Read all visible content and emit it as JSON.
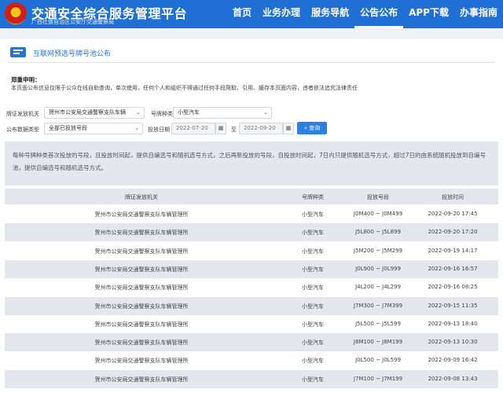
{
  "header": {
    "emblem_text": "★",
    "title": "交通安全综合服务管理平台",
    "subtitle": "广西壮族自治区公安厅交通警察局",
    "nav": [
      "首页",
      "业务办理",
      "服务导航",
      "公告公布",
      "APP下载",
      "办事指南"
    ],
    "active_nav": "公告公布",
    "brand_color": "#1f6fd4"
  },
  "page": {
    "title": "互联网预选号牌号池公布"
  },
  "notice": {
    "heading": "郑重申明：",
    "text": "本页面公布信息仅限于公众在线自助查询，单次使用，任何个人和组织不得通过任何手段爬取、引用、缓存本页面内容，违者依法追究法律责任"
  },
  "filters": {
    "issuer_label": "牌证发放机关",
    "issuer_value": "贺州市公安局交通警察支队车辆",
    "plate_type_label": "号牌种类",
    "plate_type_value": "小型汽车",
    "data_type_label": "公布数据类型",
    "data_type_value": "全部已投放号段",
    "date_label": "投放日期",
    "date_from": "2022-07-20",
    "date_sep": "至",
    "date_to": "2022-09-20",
    "calendar_icon": "▦",
    "query_button": "查询",
    "query_icon": "search-icon"
  },
  "info_text": "每种号牌种类首次投放的号段，且投放时间起，提供自编选号和随机选号方式，之后再新投放的号段，自投放时间起，7日内只提供随机选号方式，超过7日的由系统随机投放到自编号池，提供自编选号和随机选号方式。",
  "table": {
    "columns": [
      "牌证发放机关",
      "号牌种类",
      "投放号段",
      "投放时间"
    ],
    "rows": [
      [
        "贺州市公安局交通警察支队车辆管理所",
        "小型汽车",
        "J0M400 ~ J0M499",
        "2022-09-20 17:45"
      ],
      [
        "贺州市公安局交通警察支队车辆管理所",
        "小型汽车",
        "J5L800 ~ J5L899",
        "2022-09-20 17:20"
      ],
      [
        "贺州市公安局交通警察支队车辆管理所",
        "小型汽车",
        "J5M200 ~ J5M299",
        "2022-09-19 14:17"
      ],
      [
        "贺州市公安局交通警察支队车辆管理所",
        "小型汽车",
        "J0L900 ~ J0L999",
        "2022-09-16 16:57"
      ],
      [
        "贺州市公安局交通警察支队车辆管理所",
        "小型汽车",
        "J4L200 ~ J4L299",
        "2022-09-16 08:25"
      ],
      [
        "贺州市公安局交通警察支队车辆管理所",
        "小型汽车",
        "J7M300 ~ J7M399",
        "2022-09-15 11:35"
      ],
      [
        "贺州市公安局交通警察支队车辆管理所",
        "小型汽车",
        "J5L500 ~ J5L599",
        "2022-09-13 18:40"
      ],
      [
        "贺州市公安局交通警察支队车辆管理所",
        "小型汽车",
        "J8M100 ~ J8M199",
        "2022-09-13 10:30"
      ],
      [
        "贺州市公安局交通警察支队车辆管理所",
        "小型汽车",
        "J0L500 ~ J0L599",
        "2022-09-09 16:42"
      ],
      [
        "贺州市公安局交通警察支队车辆管理所",
        "小型汽车",
        "J7M100 ~ J7M199",
        "2022-09-08 13:43"
      ]
    ]
  }
}
